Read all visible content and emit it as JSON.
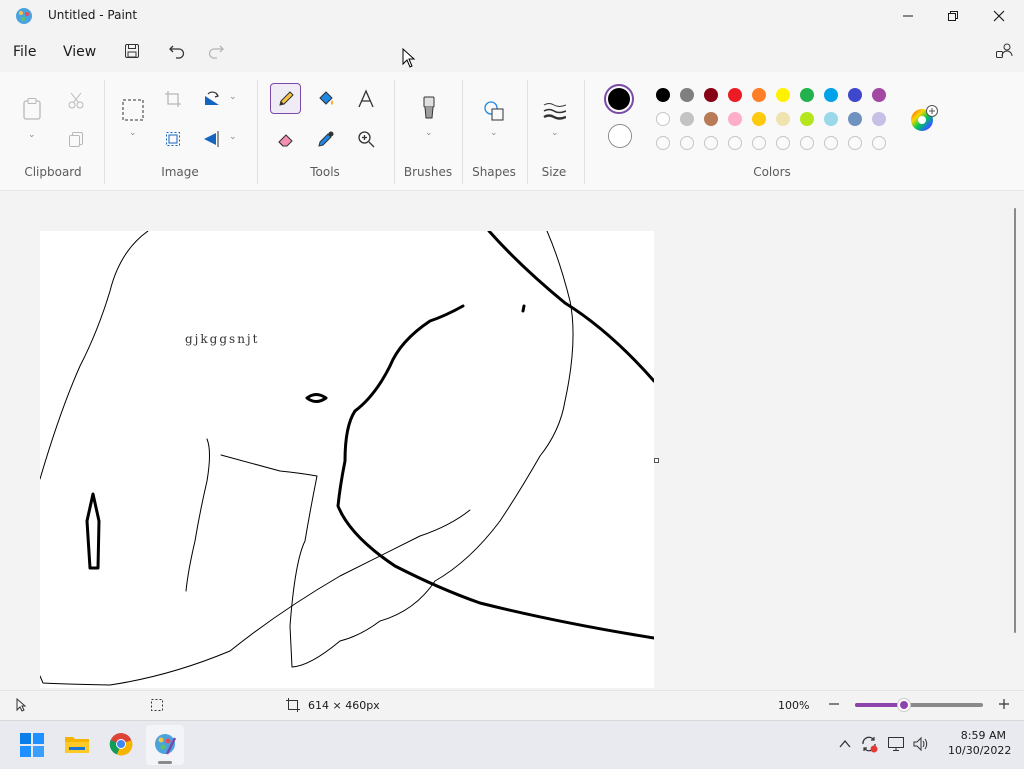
{
  "window": {
    "title": "Untitled - Paint"
  },
  "menu": {
    "file": "File",
    "view": "View"
  },
  "ribbon": {
    "groups": {
      "clipboard": "Clipboard",
      "image": "Image",
      "tools": "Tools",
      "brushes": "Brushes",
      "shapes": "Shapes",
      "size": "Size",
      "colors": "Colors"
    },
    "active_tool": "pencil",
    "primary_color": "#000000",
    "secondary_color": "#ffffff",
    "palette_row1": [
      "#000000",
      "#7f7f7f",
      "#880015",
      "#ed1c24",
      "#ff7f27",
      "#fff200",
      "#22b14c",
      "#00a2e8",
      "#3f48cc",
      "#a349a4"
    ],
    "palette_row2": [
      "#ffffff",
      "#c3c3c3",
      "#b97a57",
      "#ffaec9",
      "#ffc90e",
      "#efe4b0",
      "#b5e61d",
      "#99d9ea",
      "#7092be",
      "#c8bfe7"
    ]
  },
  "canvas": {
    "text": "gjkggsnjt"
  },
  "status": {
    "canvas_size": "614 × 460px",
    "zoom": "100%",
    "zoom_fraction": 0.5
  },
  "taskbar": {
    "time": "8:59 AM",
    "date": "10/30/2022"
  }
}
